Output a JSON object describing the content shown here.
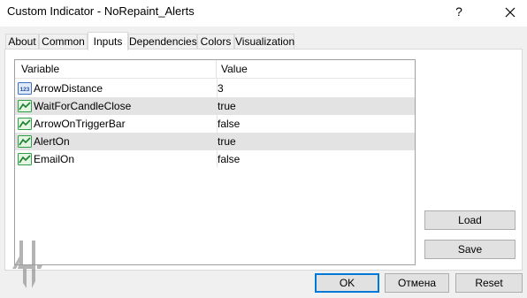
{
  "window": {
    "title": "Custom Indicator - NoRepaint_Alerts",
    "help_label": "?"
  },
  "tabs": [
    {
      "label": "About"
    },
    {
      "label": "Common"
    },
    {
      "label": "Inputs",
      "active": true
    },
    {
      "label": "Dependencies"
    },
    {
      "label": "Colors"
    },
    {
      "label": "Visualization"
    }
  ],
  "grid": {
    "headers": {
      "variable": "Variable",
      "value": "Value"
    },
    "rows": [
      {
        "name": "ArrowDistance",
        "value": "3",
        "icon": "integer-param-icon"
      },
      {
        "name": "WaitForCandleClose",
        "value": "true",
        "icon": "bool-param-icon"
      },
      {
        "name": "ArrowOnTriggerBar",
        "value": "false",
        "icon": "bool-param-icon"
      },
      {
        "name": "AlertOn",
        "value": "true",
        "icon": "bool-param-icon"
      },
      {
        "name": "EmailOn",
        "value": "false",
        "icon": "bool-param-icon"
      }
    ]
  },
  "side_buttons": {
    "load": "Load",
    "save": "Save"
  },
  "footer_buttons": {
    "ok": "OK",
    "cancel": "Отмена",
    "reset": "Reset"
  },
  "colors": {
    "accent": "#0078d7",
    "row_alt": "#e3e3e3",
    "bool_icon": "#2ea043",
    "int_icon": "#3a6fc4"
  }
}
